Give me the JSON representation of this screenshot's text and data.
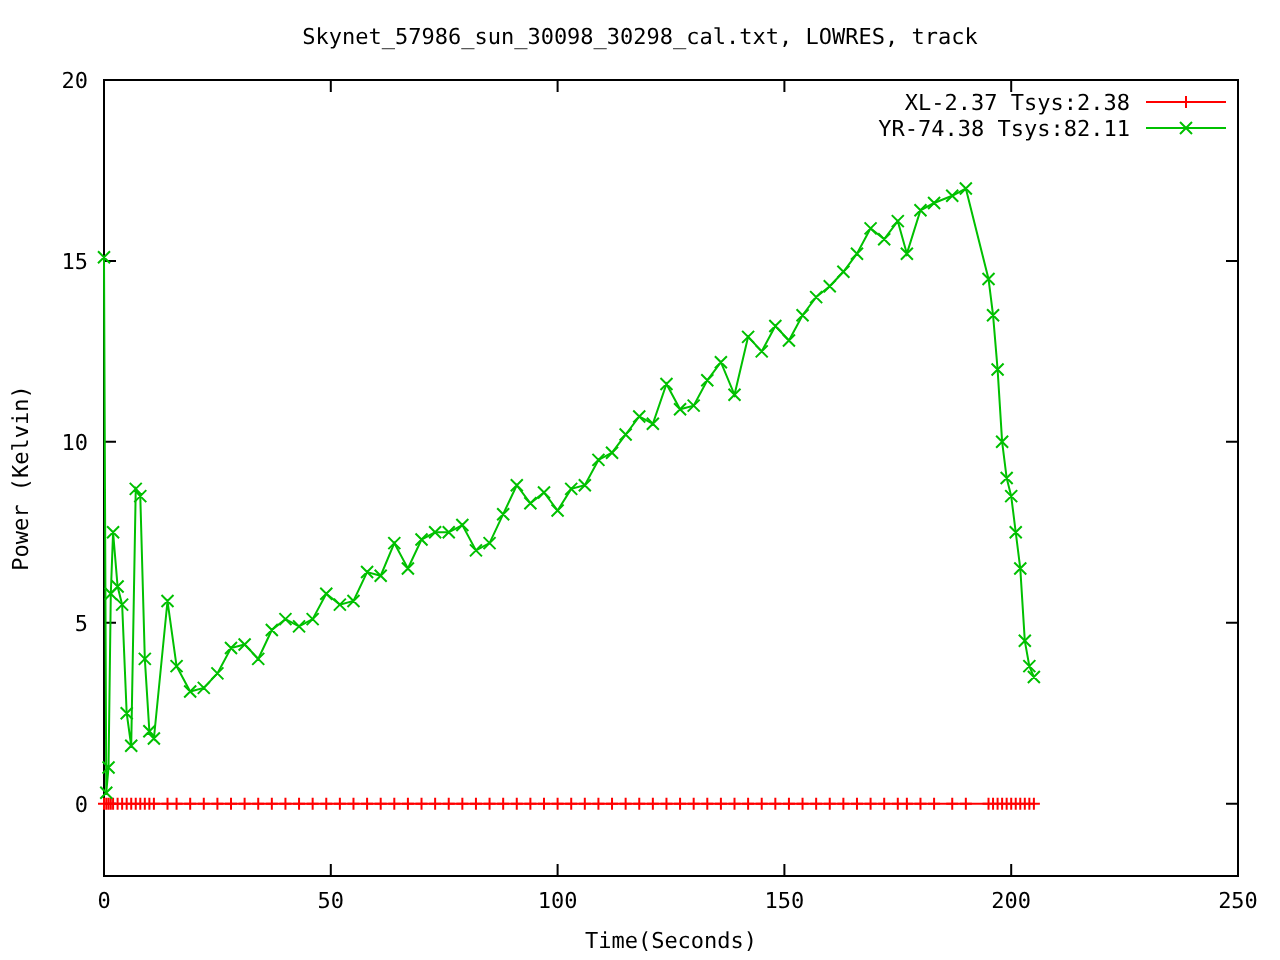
{
  "chart_data": {
    "type": "line",
    "title": "Skynet_57986_sun_30098_30298_cal.txt, LOWRES, track",
    "xlabel": "Time(Seconds)",
    "ylabel": "Power (Kelvin)",
    "x": [
      0,
      0.5,
      1,
      1.5,
      2,
      3,
      4,
      5,
      6,
      7,
      8,
      9,
      10,
      11,
      14,
      16,
      19,
      22,
      25,
      28,
      31,
      34,
      37,
      40,
      43,
      46,
      49,
      52,
      55,
      58,
      61,
      64,
      67,
      70,
      73,
      76,
      79,
      82,
      85,
      88,
      91,
      94,
      97,
      100,
      103,
      106,
      109,
      112,
      115,
      118,
      121,
      124,
      127,
      130,
      133,
      136,
      139,
      142,
      145,
      148,
      151,
      154,
      157,
      160,
      163,
      166,
      169,
      172,
      175,
      177,
      180,
      183,
      187,
      190,
      195,
      196,
      197,
      198,
      199,
      200,
      201,
      202,
      203,
      204,
      205
    ],
    "series": [
      {
        "name": "XL-2.37 Tsys:2.38",
        "color": "#ff0000",
        "marker": "plus",
        "values": [
          0,
          0,
          0,
          0,
          0,
          0,
          0,
          0,
          0,
          0,
          0,
          0,
          0,
          0,
          0,
          0,
          0,
          0,
          0,
          0,
          0,
          0,
          0,
          0,
          0,
          0,
          0,
          0,
          0,
          0,
          0,
          0,
          0,
          0,
          0,
          0,
          0,
          0,
          0,
          0,
          0,
          0,
          0,
          0,
          0,
          0,
          0,
          0,
          0,
          0,
          0,
          0,
          0,
          0,
          0,
          0,
          0,
          0,
          0,
          0,
          0,
          0,
          0,
          0,
          0,
          0,
          0,
          0,
          0,
          0,
          0,
          0,
          0,
          0,
          0,
          0,
          0,
          0,
          0,
          0,
          0,
          0,
          0,
          0,
          0
        ]
      },
      {
        "name": "YR-74.38 Tsys:82.11",
        "color": "#00c000",
        "marker": "cross",
        "values": [
          15.1,
          0.3,
          1,
          5.8,
          7.5,
          6,
          5.5,
          2.5,
          1.6,
          8.7,
          8.5,
          4,
          2,
          1.8,
          5.6,
          3.8,
          3.1,
          3.2,
          3.6,
          4.3,
          4.4,
          4,
          4.8,
          5.1,
          4.9,
          5.1,
          5.8,
          5.5,
          5.6,
          6.4,
          6.3,
          7.2,
          6.5,
          7.3,
          7.5,
          7.5,
          7.7,
          7,
          7.2,
          8,
          8.8,
          8.3,
          8.6,
          8.1,
          8.7,
          8.8,
          9.5,
          9.7,
          10.2,
          10.7,
          10.5,
          11.6,
          10.9,
          11,
          11.7,
          12.2,
          11.3,
          12.9,
          12.5,
          13.2,
          12.8,
          13.5,
          14,
          14.3,
          14.7,
          15.2,
          15.9,
          15.6,
          16.1,
          15.2,
          16.4,
          16.6,
          16.8,
          17,
          14.5,
          13.5,
          12,
          10,
          9,
          8.5,
          7.5,
          6.5,
          4.5,
          3.8,
          3.5
        ]
      }
    ],
    "legend": "top-right",
    "xlim": [
      0,
      250
    ],
    "ylim": [
      -2,
      20
    ],
    "xticks": [
      0,
      50,
      100,
      150,
      200,
      250
    ],
    "yticks": [
      0,
      5,
      10,
      15,
      20
    ]
  }
}
